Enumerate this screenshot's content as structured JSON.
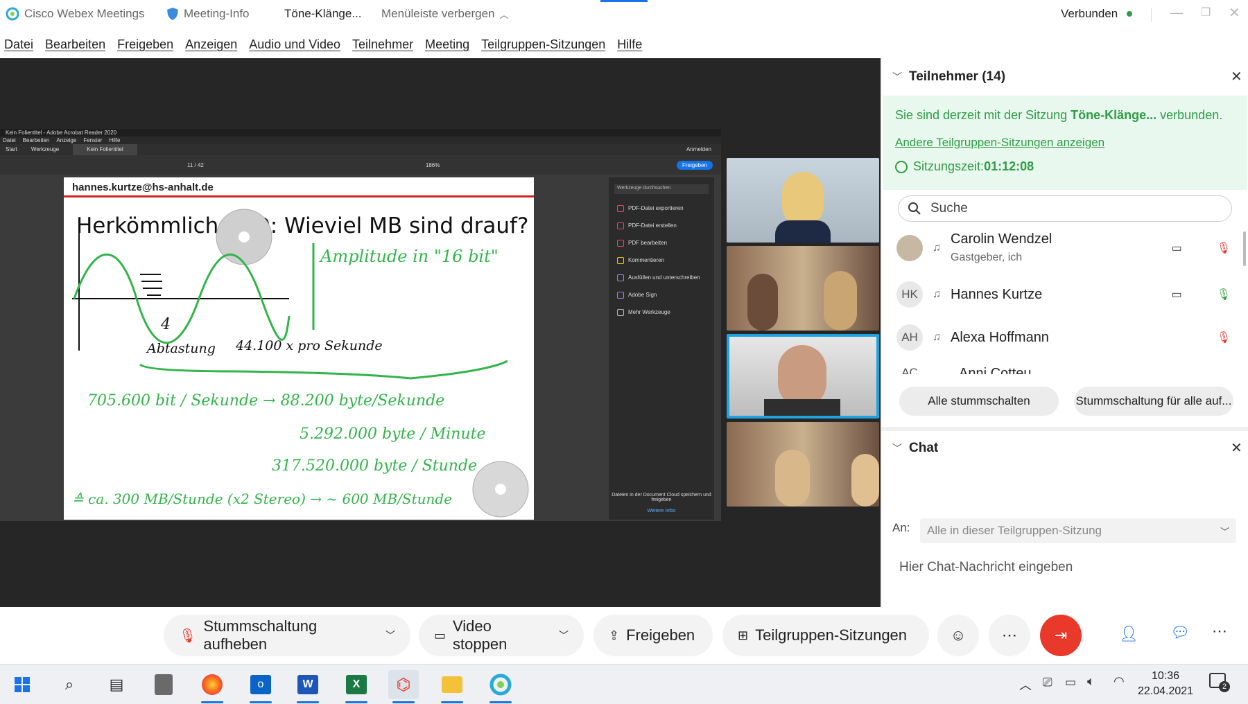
{
  "titlebar": {
    "app_name": "Cisco Webex Meetings",
    "meeting_info": "Meeting-Info",
    "session": "Töne-Klänge...",
    "hide_menu": "Menüleiste verbergen",
    "status": "Verbunden"
  },
  "menu": [
    "Datei",
    "Bearbeiten",
    "Freigeben",
    "Anzeigen",
    "Audio und Video",
    "Teilnehmer",
    "Meeting",
    "Teilgruppen-Sitzungen",
    "Hilfe"
  ],
  "acrobat": {
    "title": "Kein Folientitel - Adobe Acrobat Reader 2020",
    "menu": [
      "Datei",
      "Bearbeiten",
      "Anzeige",
      "Fenster",
      "Hilfe"
    ],
    "tabs": [
      "Start",
      "Werkzeuge",
      "Kein Folientitel"
    ],
    "login": "Anmelden",
    "share_button": "Freigeben",
    "page": "11 / 42",
    "zoom": "186%",
    "search_tools": "Werkzeuge durchsuchen",
    "tools": [
      "PDF-Datei exportieren",
      "PDF-Datei erstellen",
      "PDF bearbeiten",
      "Kommentieren",
      "Ausfüllen und unterschreiben",
      "Adobe Sign",
      "Mehr Werkzeuge"
    ],
    "cloud_text": "Dateien in der Document Cloud speichern und freigeben",
    "more_info": "Weitere Infos"
  },
  "slide": {
    "email": "hannes.kurtze@hs-anhalt.de",
    "title": "Herkömmliche CD: Wieviel MB sind drauf?",
    "hw_amplitude": "Amplitude in \"16 bit\"",
    "hw_sampling": "Abtastung",
    "hw_rate": "44.100 x pro Sekunde",
    "hw_line1": "705.600 bit / Sekunde → 88.200 byte/Sekunde",
    "hw_line2": "5.292.000 byte / Minute",
    "hw_line3": "317.520.000 byte / Stunde",
    "hw_line4": "≙ ca. 300 MB/Stunde (x2 Stereo) → ~ 600 MB/Stunde",
    "hw_num": "4"
  },
  "participants": {
    "header": "Teilnehmer (14)",
    "info_prefix": "Sie sind derzeit mit der Sitzung ",
    "info_session": "Töne-Klänge...",
    "info_suffix": " verbunden.",
    "other_sessions": "Andere Teilgruppen-Sitzungen anzeigen",
    "time_label": "Sitzungszeit: ",
    "time_value": "01:12:08",
    "search_placeholder": "Suche",
    "list": [
      {
        "name": "Carolin Wendzel",
        "sub": "Gastgeber, ich",
        "initials": ""
      },
      {
        "name": "Hannes Kurtze",
        "sub": "",
        "initials": "HK"
      },
      {
        "name": "Alexa Hoffmann",
        "sub": "",
        "initials": "AH"
      },
      {
        "name": "Anni Cotteu",
        "sub": "",
        "initials": "AC"
      }
    ],
    "mute_all": "Alle stummschalten",
    "unmute_all": "Stummschaltung für alle auf..."
  },
  "chat": {
    "header": "Chat",
    "to_label": "An:",
    "to_value": "Alle in dieser Teilgruppen-Sitzung",
    "placeholder": "Hier Chat-Nachricht eingeben"
  },
  "controls": {
    "unmute": "Stummschaltung aufheben",
    "video_stop": "Video stoppen",
    "share": "Freigeben",
    "breakout": "Teilgruppen-Sitzungen"
  },
  "taskbar": {
    "time": "10:36",
    "date": "22.04.2021",
    "notifications": "2"
  },
  "colors": {
    "accent_green": "#2e9c45",
    "end_red": "#e8392b",
    "panel_green_bg": "#e9f8ee",
    "selected_video": "#1fa3e0"
  }
}
